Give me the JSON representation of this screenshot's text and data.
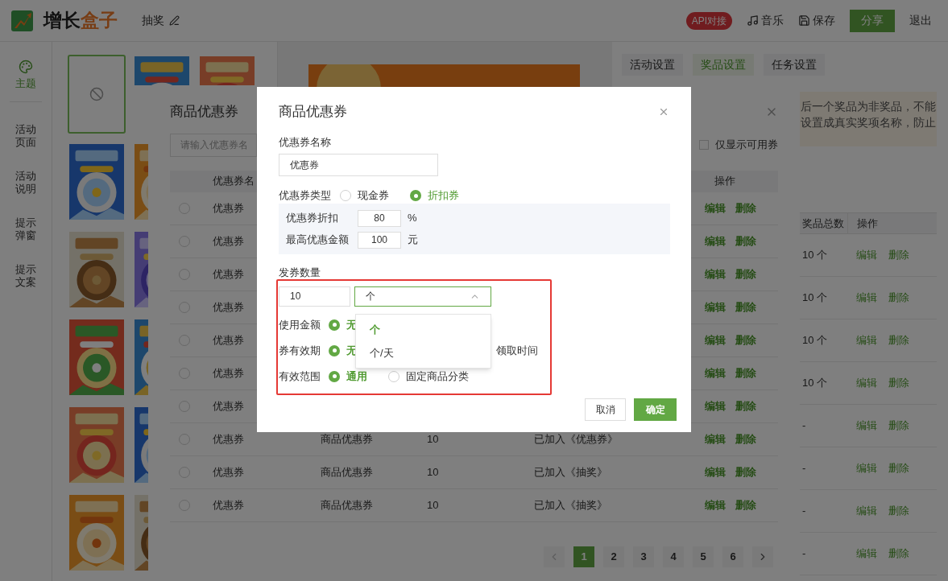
{
  "header": {
    "logo": [
      "增长",
      "盒子"
    ],
    "project_title": "抽奖",
    "api_badge": "API对接",
    "actions": [
      {
        "kind": "music",
        "label": "音乐"
      },
      {
        "kind": "save",
        "label": "保存"
      }
    ],
    "share": "分享",
    "logout": "退出"
  },
  "sidebar": {
    "items": [
      {
        "label": "主题",
        "selected": true
      },
      {
        "label": "活动页面",
        "selected": false
      },
      {
        "label": "活动说明",
        "selected": false
      },
      {
        "label": "提示弹窗",
        "selected": false
      },
      {
        "label": "提示文案",
        "selected": false
      }
    ]
  },
  "theme_rows": [
    [
      {
        "kind": "none",
        "selected": true
      },
      {
        "kind": "picture",
        "selected": false
      },
      {
        "kind": "picture",
        "selected": false
      }
    ],
    [
      {
        "kind": "picture",
        "selected": false
      },
      {
        "kind": "picture",
        "selected": false
      }
    ],
    [
      {
        "kind": "picture",
        "selected": false
      },
      {
        "kind": "picture",
        "selected": false
      }
    ],
    [
      {
        "kind": "picture",
        "selected": false
      },
      {
        "kind": "picture",
        "selected": false
      }
    ],
    [
      {
        "kind": "picture",
        "selected": false
      },
      {
        "kind": "picture",
        "selected": false
      }
    ],
    [
      {
        "kind": "picture",
        "selected": false
      },
      {
        "kind": "picture",
        "selected": false
      }
    ]
  ],
  "settings": {
    "tabs": [
      {
        "label": "活动设置",
        "selected": false
      },
      {
        "label": "奖品设置",
        "selected": true
      },
      {
        "label": "任务设置",
        "selected": false
      }
    ],
    "notice_lines": [
      "后一个奖品为非奖品，不能",
      "设置成真实奖项名称，防止"
    ],
    "prize_table": {
      "columns": [
        "奖品总数",
        "操作"
      ],
      "rows": [
        {
          "total": "10 个",
          "actions": [
            "编辑",
            "删除"
          ]
        },
        {
          "total": "10 个",
          "actions": [
            "编辑",
            "删除"
          ]
        },
        {
          "total": "10 个",
          "actions": [
            "编辑",
            "删除"
          ]
        },
        {
          "total": "10 个",
          "actions": [
            "编辑",
            "删除"
          ]
        },
        {
          "total": "-",
          "actions": [
            "编辑",
            "删除"
          ]
        },
        {
          "total": "-",
          "actions": [
            "编辑",
            "删除"
          ]
        },
        {
          "total": "-",
          "actions": [
            "编辑",
            "删除"
          ]
        },
        {
          "total": "-",
          "actions": [
            "编辑",
            "删除"
          ]
        }
      ]
    }
  },
  "coupon_picker": {
    "title": "商品优惠券",
    "search_placeholder": "请输入优惠券名",
    "available_only": {
      "label": "仅显示可用券",
      "checked": false
    },
    "columns": [
      "优惠券名",
      "操作"
    ],
    "rows": [
      {
        "selected": false,
        "name": "优惠券",
        "actions": [
          "编辑",
          "删除"
        ]
      },
      {
        "selected": false,
        "name": "优惠券",
        "actions": [
          "编辑",
          "删除"
        ]
      },
      {
        "selected": false,
        "name": "优惠券",
        "actions": [
          "编辑",
          "删除"
        ]
      },
      {
        "selected": false,
        "name": "优惠券",
        "actions": [
          "编辑",
          "删除"
        ]
      },
      {
        "selected": false,
        "name": "优惠券",
        "actions": [
          "编辑",
          "删除"
        ]
      },
      {
        "selected": false,
        "name": "优惠券",
        "actions": [
          "编辑",
          "删除"
        ]
      },
      {
        "selected": false,
        "name": "优惠券",
        "actions": [
          "编辑",
          "删除"
        ]
      },
      {
        "selected": false,
        "name": "优惠券",
        "type": "商品优惠券",
        "count": "10",
        "status": "已加入《优惠券》",
        "actions": [
          "编辑",
          "删除"
        ]
      },
      {
        "selected": false,
        "name": "优惠券",
        "type": "商品优惠券",
        "count": "10",
        "status": "已加入《抽奖》",
        "actions": [
          "编辑",
          "删除"
        ]
      },
      {
        "selected": false,
        "name": "优惠券",
        "type": "商品优惠券",
        "count": "10",
        "status": "已加入《抽奖》",
        "actions": [
          "编辑",
          "删除"
        ]
      }
    ],
    "pages": [
      {
        "label": "1",
        "selected": true
      },
      {
        "label": "2",
        "selected": false
      },
      {
        "label": "3",
        "selected": false
      },
      {
        "label": "4",
        "selected": false
      },
      {
        "label": "5",
        "selected": false
      },
      {
        "label": "6",
        "selected": false
      }
    ]
  },
  "coupon_dialog": {
    "title": "商品优惠券",
    "name_field": {
      "label": "优惠券名称",
      "value": "优惠券"
    },
    "type": {
      "label": "优惠券类型",
      "options": [
        {
          "label": "现金券",
          "selected": false
        },
        {
          "label": "折扣券",
          "selected": true
        }
      ]
    },
    "discount_fields": [
      {
        "label": "优惠券折扣",
        "value": "80",
        "unit": "%"
      },
      {
        "label": "最高优惠金额",
        "value": "100",
        "unit": "元"
      }
    ],
    "quantity": {
      "label": "发券数量",
      "value": "10",
      "unit_select": {
        "value": "个",
        "expanded": true,
        "options": [
          {
            "label": "个",
            "selected": true
          },
          {
            "label": "个/天",
            "selected": false
          }
        ]
      }
    },
    "radio_rows": [
      {
        "label": "使用金额",
        "options": [
          {
            "label": "无",
            "selected": true
          }
        ]
      },
      {
        "label": "券有效期",
        "options": [
          {
            "label": "无",
            "selected": true
          }
        ],
        "trailing_text": "领取时间"
      },
      {
        "label": "有效范围",
        "options": [
          {
            "label": "通用",
            "selected": true
          },
          {
            "label": "固定商品分类",
            "selected": false
          }
        ]
      }
    ],
    "buttons": {
      "cancel": "取消",
      "confirm": "确定"
    }
  }
}
